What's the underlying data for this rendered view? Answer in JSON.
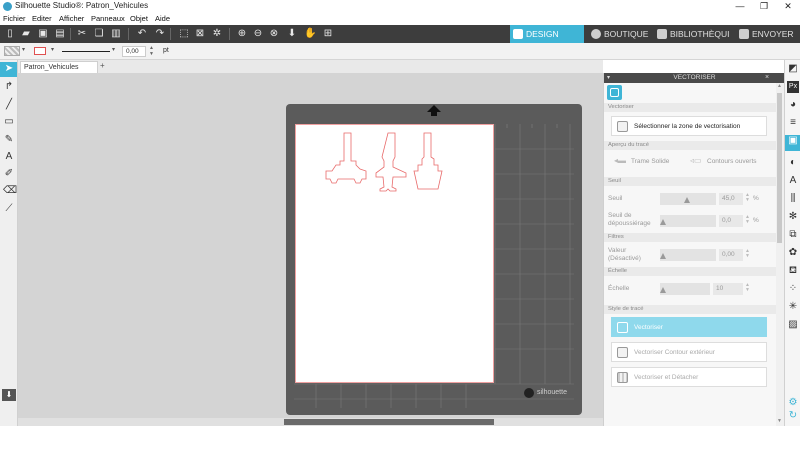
{
  "window": {
    "title": "Silhouette Studio®: Patron_Vehicules",
    "controls": [
      "—",
      "❐",
      "✕"
    ]
  },
  "menu": [
    "Fichier",
    "Editer",
    "Afficher",
    "Panneaux",
    "Objet",
    "Aide"
  ],
  "nav_tabs": [
    {
      "label": "DESIGN",
      "icon": "grid-icon"
    },
    {
      "label": "BOUTIQUE",
      "icon": "shop-icon"
    },
    {
      "label": "BIBLIOTHÈQUI",
      "icon": "library-icon"
    },
    {
      "label": "ENVOYER",
      "icon": "send-icon"
    }
  ],
  "secondary_bar": {
    "line_width_value": "0,00",
    "line_width_unit": "pt"
  },
  "document": {
    "tab_label": "Patron_Vehicules",
    "add_tab": "+"
  },
  "mat": {
    "brand": "silhouette"
  },
  "panel": {
    "title": "VECTORISER",
    "section_vectoriser": "Vectoriser",
    "select_area_button": "Sélectionner la zone de vectorisation",
    "section_preview": "Aperçu du tracé",
    "preview_solid": "Trame Solide",
    "preview_open": "Contours ouverts",
    "section_threshold": "Seuil",
    "threshold_label": "Seuil",
    "threshold_value": "45,0",
    "threshold_unit": "%",
    "despeckle_label_1": "Seuil de",
    "despeckle_label_2": "dépoussiérage",
    "despeckle_value": "0,0",
    "despeckle_unit": "%",
    "section_filters": "Filtres",
    "value_label_1": "Valeur",
    "value_label_2": "(Désactivé)",
    "value_value": "0,00",
    "section_scale": "Échelle",
    "scale_label": "Échelle",
    "scale_value": "10",
    "section_style": "Style de tracé",
    "btn_vectorise": "Vectoriser",
    "btn_outer": "Vectoriser Contour extérieur",
    "btn_detach": "Vectoriser et Détacher"
  },
  "colors": {
    "accent": "#3fb5d6",
    "toolbar": "#3d3d3d",
    "cut_line": "#e86a6a"
  }
}
